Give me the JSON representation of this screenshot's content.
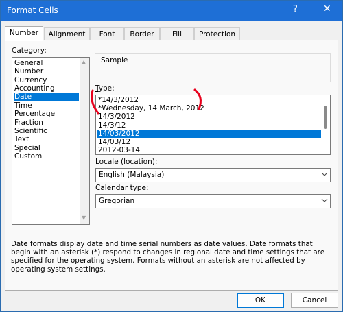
{
  "window": {
    "title": "Format Cells",
    "help_glyph": "?",
    "close_glyph": "✕"
  },
  "tabs": [
    {
      "label": "Number",
      "active": true
    },
    {
      "label": "Alignment"
    },
    {
      "label": "Font"
    },
    {
      "label": "Border"
    },
    {
      "label": "Fill"
    },
    {
      "label": "Protection"
    }
  ],
  "category": {
    "label": "Category:",
    "items": [
      "General",
      "Number",
      "Currency",
      "Accounting",
      "Date",
      "Time",
      "Percentage",
      "Fraction",
      "Scientific",
      "Text",
      "Special",
      "Custom"
    ],
    "selected": "Date"
  },
  "sample": {
    "label": "Sample",
    "value": ""
  },
  "type": {
    "label": "Type:",
    "items": [
      "*14/3/2012",
      "*Wednesday, 14 March, 2012",
      "14/3/2012",
      "14/3/12",
      "14/03/2012",
      "14/03/12",
      "2012-03-14"
    ],
    "selected": "14/03/2012"
  },
  "locale": {
    "label": "Locale (location):",
    "value": "English (Malaysia)"
  },
  "calendar": {
    "label": "Calendar type:",
    "value": "Gregorian"
  },
  "description": "Date formats display date and time serial numbers as date values.  Date formats that begin with an asterisk (*) respond to changes in regional date and time settings that are specified for the operating system. Formats without an asterisk are not affected by operating system settings.",
  "buttons": {
    "ok": "OK",
    "cancel": "Cancel"
  },
  "icons": {
    "scroll_up": "▲",
    "scroll_down": "▼",
    "dropdown": "chevron-down-icon"
  },
  "colors": {
    "titlebar": "#1e6fd6",
    "selection": "#0078d7",
    "annotation": "#e8001c"
  }
}
